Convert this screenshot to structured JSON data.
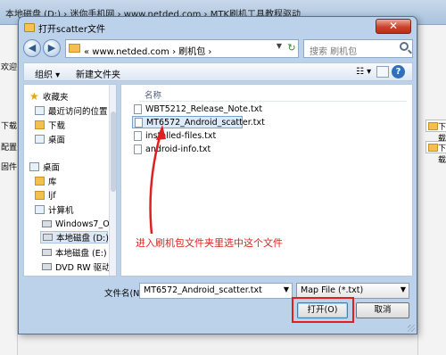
{
  "background_window": {
    "title": "本地磁盘 (D:) › 迷你手机网 › www.netded.com › MTK刷机工具教程驱动",
    "left_labels": [
      "欢迎",
      "下载",
      "配置",
      "固件"
    ],
    "right_labels": [
      "下载",
      "下载"
    ]
  },
  "dialog": {
    "title": "打开scatter文件",
    "close_glyph": "✕",
    "nav": {
      "back_glyph": "◀",
      "forward_glyph": "▶",
      "breadcrumb": "«  www.netded.com  ›  刷机包  ›",
      "refresh_glyph": "↻",
      "search_placeholder": "搜索 刷机包"
    },
    "toolbar": {
      "organize": "组织 ▾",
      "new_folder": "新建文件夹",
      "view_glyph": "☷ ▾",
      "help_glyph": "?"
    },
    "tree": [
      {
        "label": "收藏夹",
        "icon": "star-icon"
      },
      {
        "label": "最近访问的位置",
        "icon": "recent-places-icon"
      },
      {
        "label": "下载",
        "icon": "downloads-icon"
      },
      {
        "label": "桌面",
        "icon": "desktop-icon"
      },
      {
        "label": "桌面",
        "icon": "desktop-icon"
      },
      {
        "label": "库",
        "icon": "library-icon"
      },
      {
        "label": "ljf",
        "icon": "user-folder-icon"
      },
      {
        "label": "计算机",
        "icon": "computer-icon"
      },
      {
        "label": "Windows7_OS",
        "icon": "drive-icon"
      },
      {
        "label": "本地磁盘 (D:)",
        "icon": "drive-icon"
      },
      {
        "label": "本地磁盘 (E:)",
        "icon": "drive-icon"
      },
      {
        "label": "DVD RW 驱动",
        "icon": "dvd-drive-icon"
      }
    ],
    "files": {
      "column_header": "名称",
      "items": [
        "WBT5212_Release_Note.txt",
        "MT6572_Android_scatter.txt",
        "installed-files.txt",
        "android-info.txt"
      ]
    },
    "filename": {
      "label": "文件名(N):",
      "value": "MT6572_Android_scatter.txt"
    },
    "file_type": "Map File (*.txt)",
    "open_label": "打开(O)",
    "cancel_label": "取消"
  },
  "annotation": {
    "text": "进入刷机包文件夹里选中这个文件",
    "color": "#e02020"
  }
}
